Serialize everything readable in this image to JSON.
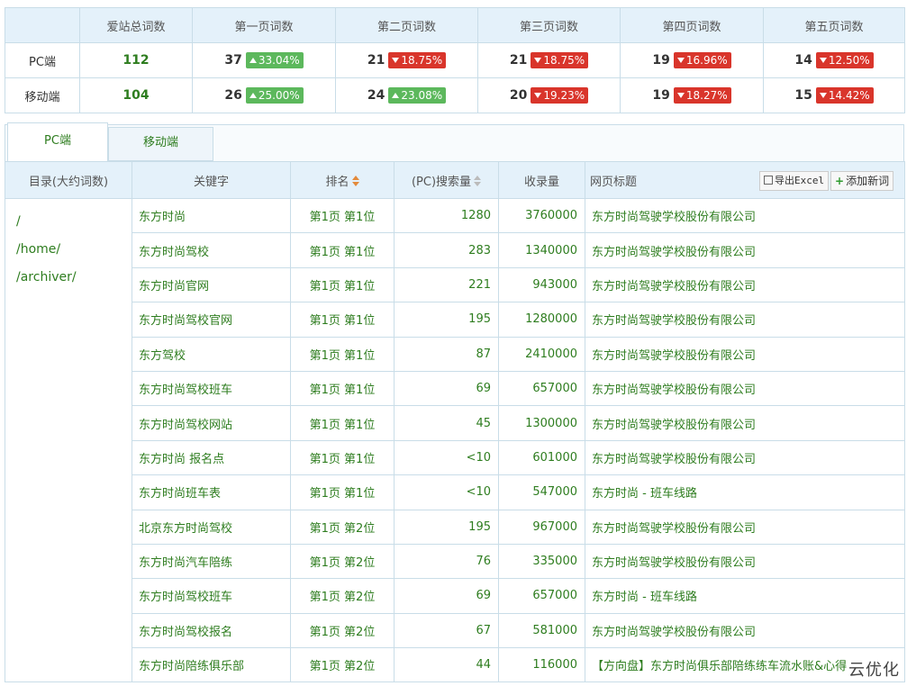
{
  "summary": {
    "headers": [
      "",
      "爱站总词数",
      "第一页词数",
      "第二页词数",
      "第三页词数",
      "第四页词数",
      "第五页词数"
    ],
    "rows": [
      {
        "label": "PC端",
        "total": "112",
        "pages": [
          {
            "count": "37",
            "pct": "33.04%",
            "dir": "up"
          },
          {
            "count": "21",
            "pct": "18.75%",
            "dir": "down"
          },
          {
            "count": "21",
            "pct": "18.75%",
            "dir": "down"
          },
          {
            "count": "19",
            "pct": "16.96%",
            "dir": "down"
          },
          {
            "count": "14",
            "pct": "12.50%",
            "dir": "down"
          }
        ]
      },
      {
        "label": "移动端",
        "total": "104",
        "pages": [
          {
            "count": "26",
            "pct": "25.00%",
            "dir": "up"
          },
          {
            "count": "24",
            "pct": "23.08%",
            "dir": "up"
          },
          {
            "count": "20",
            "pct": "19.23%",
            "dir": "down"
          },
          {
            "count": "19",
            "pct": "18.27%",
            "dir": "down"
          },
          {
            "count": "15",
            "pct": "14.42%",
            "dir": "down"
          }
        ]
      }
    ]
  },
  "tabs": {
    "pc": "PC端",
    "mobile": "移动端"
  },
  "table": {
    "headers": {
      "dir": "目录(大约词数)",
      "keyword": "关键字",
      "rank": "排名",
      "volume": "(PC)搜索量",
      "indexed": "收录量",
      "title": "网页标题"
    },
    "export_label": "导出Excel",
    "add_label": "添加新词",
    "directories": [
      "/",
      "/home/",
      "/archiver/"
    ],
    "rows": [
      {
        "keyword": "东方时尚",
        "rank": "第1页 第1位",
        "volume": "1280",
        "indexed": "3760000",
        "title": "东方时尚驾驶学校股份有限公司"
      },
      {
        "keyword": "东方时尚驾校",
        "rank": "第1页 第1位",
        "volume": "283",
        "indexed": "1340000",
        "title": "东方时尚驾驶学校股份有限公司"
      },
      {
        "keyword": "东方时尚官网",
        "rank": "第1页 第1位",
        "volume": "221",
        "indexed": "943000",
        "title": "东方时尚驾驶学校股份有限公司"
      },
      {
        "keyword": "东方时尚驾校官网",
        "rank": "第1页 第1位",
        "volume": "195",
        "indexed": "1280000",
        "title": "东方时尚驾驶学校股份有限公司"
      },
      {
        "keyword": "东方驾校",
        "rank": "第1页 第1位",
        "volume": "87",
        "indexed": "2410000",
        "title": "东方时尚驾驶学校股份有限公司"
      },
      {
        "keyword": "东方时尚驾校班车",
        "rank": "第1页 第1位",
        "volume": "69",
        "indexed": "657000",
        "title": "东方时尚驾驶学校股份有限公司"
      },
      {
        "keyword": "东方时尚驾校网站",
        "rank": "第1页 第1位",
        "volume": "45",
        "indexed": "1300000",
        "title": "东方时尚驾驶学校股份有限公司"
      },
      {
        "keyword": "东方时尚 报名点",
        "rank": "第1页 第1位",
        "volume": "<10",
        "indexed": "601000",
        "title": "东方时尚驾驶学校股份有限公司"
      },
      {
        "keyword": "东方时尚班车表",
        "rank": "第1页 第1位",
        "volume": "<10",
        "indexed": "547000",
        "title": "东方时尚 - 班车线路"
      },
      {
        "keyword": "北京东方时尚驾校",
        "rank": "第1页 第2位",
        "volume": "195",
        "indexed": "967000",
        "title": "东方时尚驾驶学校股份有限公司"
      },
      {
        "keyword": "东方时尚汽车陪练",
        "rank": "第1页 第2位",
        "volume": "76",
        "indexed": "335000",
        "title": "东方时尚驾驶学校股份有限公司"
      },
      {
        "keyword": "东方时尚驾校班车",
        "rank": "第1页 第2位",
        "volume": "69",
        "indexed": "657000",
        "title": "东方时尚 - 班车线路"
      },
      {
        "keyword": "东方时尚驾校报名",
        "rank": "第1页 第2位",
        "volume": "67",
        "indexed": "581000",
        "title": "东方时尚驾驶学校股份有限公司"
      },
      {
        "keyword": "东方时尚陪练俱乐部",
        "rank": "第1页 第2位",
        "volume": "44",
        "indexed": "116000",
        "title": "【方向盘】东方时尚俱乐部陪练练车流水账&心得"
      }
    ]
  },
  "watermark": "云优化",
  "colors": {
    "green_text": "#2e7d1f",
    "header_bg": "#e4f1fa",
    "border": "#c9dde8",
    "badge_up": "#5cb85c",
    "badge_down": "#d9352b"
  }
}
